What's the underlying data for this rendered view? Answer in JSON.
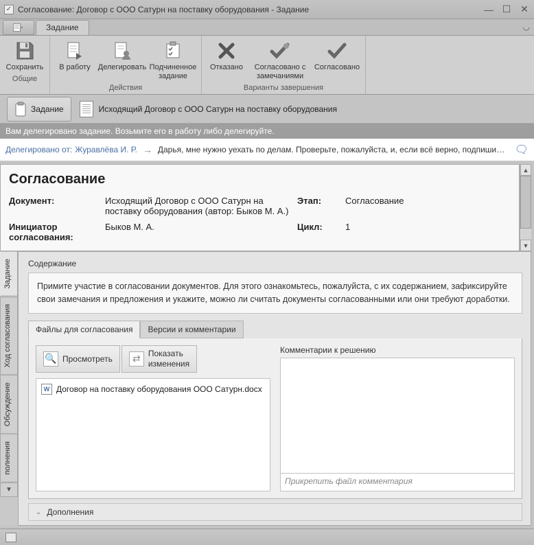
{
  "window": {
    "title": "Согласование: Договор с ООО Сатурн на поставку оборудования - Задание"
  },
  "ribbon": {
    "tab": "Задание",
    "groups": {
      "common": {
        "title": "Общие",
        "save": "Сохранить"
      },
      "actions": {
        "title": "Действия",
        "to_work": "В работу",
        "delegate": "Делегировать",
        "subtask": "Подчиненное задание"
      },
      "completion": {
        "title": "Варианты завершения",
        "refused": "Отказано",
        "approved_remarks": "Согласовано с замечаниями",
        "approved": "Согласовано"
      }
    }
  },
  "tabbar": {
    "task": "Задание",
    "doc": "Исходящий Договор с ООО Сатурн на поставку оборудования"
  },
  "info_strip": "Вам делегировано задание. Возьмите его в работу либо делегируйте.",
  "delegation": {
    "label": "Делегировано от:",
    "name": "Журавлёва И. Р.",
    "message": "Дарья, мне нужно уехать по делам. Проверьте, пожалуйста, и, если всё верно, подпишите дого..."
  },
  "card": {
    "title": "Согласование",
    "document_label": "Документ:",
    "document_value": "Исходящий Договор с ООО Сатурн на поставку оборудования (автор: Быков М. А.)",
    "stage_label": "Этап:",
    "stage_value": "Согласование",
    "initiator_label": "Инициатор согласования:",
    "initiator_value": "Быков М. А.",
    "cycle_label": "Цикл:",
    "cycle_value": "1"
  },
  "sidetabs": {
    "task": "Задание",
    "flow": "Ход согласования",
    "discuss": "Обсуждение",
    "extra": "полнения"
  },
  "lower": {
    "content_title": "Содержание",
    "instruction": "Примите участие в согласовании документов. Для этого ознакомьтесь, пожалуйста, с их содержанием, зафиксируйте свои замечания и предложения и укажите, можно ли считать документы согласованными или они требуют доработки.",
    "subtabs": {
      "files": "Файлы для согласования",
      "versions": "Версии и комментарии"
    },
    "actions": {
      "view": "Просмотреть",
      "show_changes_l1": "Показать",
      "show_changes_l2": "изменения"
    },
    "file": "Договор на поставку оборудования ООО Сатурн.docx",
    "comments_label": "Комментарии к решению",
    "attach_placeholder": "Прикрепить файл комментария",
    "additions": "Дополнения"
  }
}
